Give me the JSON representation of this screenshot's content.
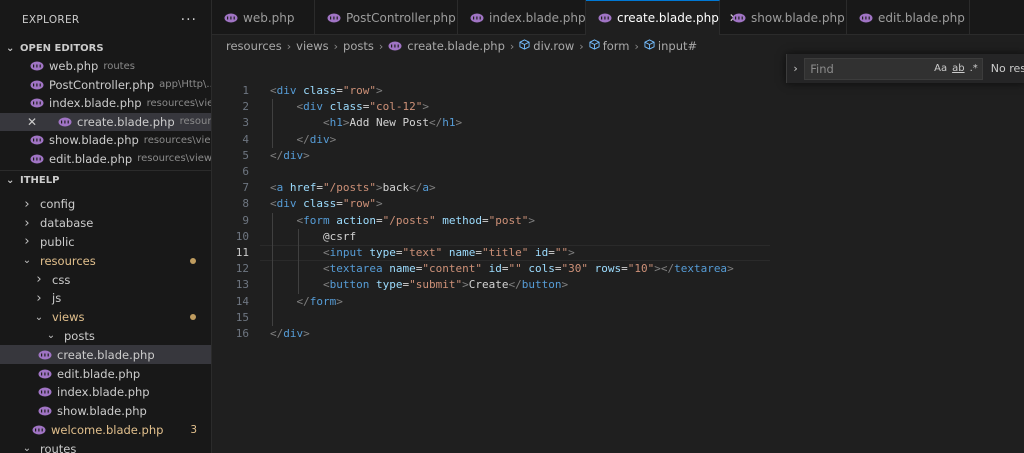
{
  "sidebar": {
    "title": "EXPLORER",
    "more": "···",
    "open_editors": {
      "label": "OPEN EDITORS",
      "items": [
        {
          "name": "web.php",
          "path": "routes"
        },
        {
          "name": "PostController.php",
          "path": "app\\Http\\..."
        },
        {
          "name": "index.blade.php",
          "path": "resources\\vie..."
        },
        {
          "name": "create.blade.php",
          "path": "resources\\vie..."
        },
        {
          "name": "show.blade.php",
          "path": "resources\\vie..."
        },
        {
          "name": "edit.blade.php",
          "path": "resources\\view..."
        }
      ]
    },
    "project": {
      "label": "ITHELP",
      "items": [
        {
          "label": "config"
        },
        {
          "label": "database"
        },
        {
          "label": "public"
        },
        {
          "label": "resources"
        },
        {
          "label": "css"
        },
        {
          "label": "js"
        },
        {
          "label": "views"
        },
        {
          "label": "posts"
        },
        {
          "label": "create.blade.php"
        },
        {
          "label": "edit.blade.php"
        },
        {
          "label": "index.blade.php"
        },
        {
          "label": "show.blade.php"
        },
        {
          "label": "welcome.blade.php",
          "badge": "3"
        },
        {
          "label": "routes"
        }
      ]
    }
  },
  "tabs": [
    {
      "label": "web.php"
    },
    {
      "label": "PostController.php"
    },
    {
      "label": "index.blade.php"
    },
    {
      "label": "create.blade.php",
      "close": "✕"
    },
    {
      "label": "show.blade.php"
    },
    {
      "label": "edit.blade.php"
    }
  ],
  "breadcrumb": [
    "resources",
    "views",
    "posts",
    "create.blade.php",
    "div.row",
    "form",
    "input#"
  ],
  "editor": {
    "current_line": 11,
    "line_numbers": [
      "1",
      "2",
      "3",
      "4",
      "5",
      "6",
      "7",
      "8",
      "9",
      "10",
      "11",
      "12",
      "13",
      "14",
      "15",
      "16"
    ],
    "lines": [
      "<div class=\"row\">",
      "    <div class=\"col-12\">",
      "        <h1>Add New Post</h1>",
      "    </div>",
      "</div>",
      "",
      "<a href=\"/posts\">back</a>",
      "<div class=\"row\">",
      "    <form action=\"/posts\" method=\"post\">",
      "        @csrf",
      "        <input type=\"text\" name=\"title\" id=\"\">",
      "        <textarea name=\"content\" id=\"\" cols=\"30\" rows=\"10\"></textarea>",
      "        <button type=\"submit\">Create</button>",
      "    </form>",
      "",
      "</div>"
    ]
  },
  "find": {
    "placeholder": "Find",
    "opt_case": "Aa",
    "opt_word": "ab",
    "opt_regex": ".*",
    "result": "No res"
  }
}
